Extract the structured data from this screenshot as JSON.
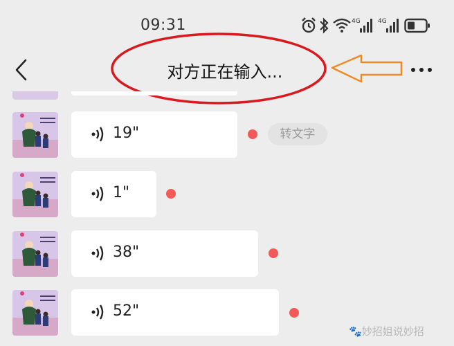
{
  "status_bar": {
    "time": "09:31",
    "icons": [
      "alarm-icon",
      "bluetooth-icon",
      "wifi-icon",
      "signal-4g-icon",
      "signal-4g-icon",
      "battery-icon"
    ],
    "network_label_1": "4G",
    "network_label_2": "4G"
  },
  "nav": {
    "title": "对方正在输入...",
    "back_icon": "chevron-left-icon",
    "more_icon": "more-dots-icon"
  },
  "annotation": {
    "ellipse_color": "#d9191d",
    "arrow_color": "#f08a24"
  },
  "messages": [
    {
      "duration": "19\""
    },
    {
      "duration": "1\""
    },
    {
      "duration": "38\""
    },
    {
      "duration": "52\""
    }
  ],
  "transcribe_label": "转文字",
  "watermark": "妙招姐说妙招",
  "colors": {
    "background": "#ededed",
    "bubble": "#ffffff",
    "unread_dot": "#f25a5a",
    "avatar_bg": "#d9c9e6"
  }
}
